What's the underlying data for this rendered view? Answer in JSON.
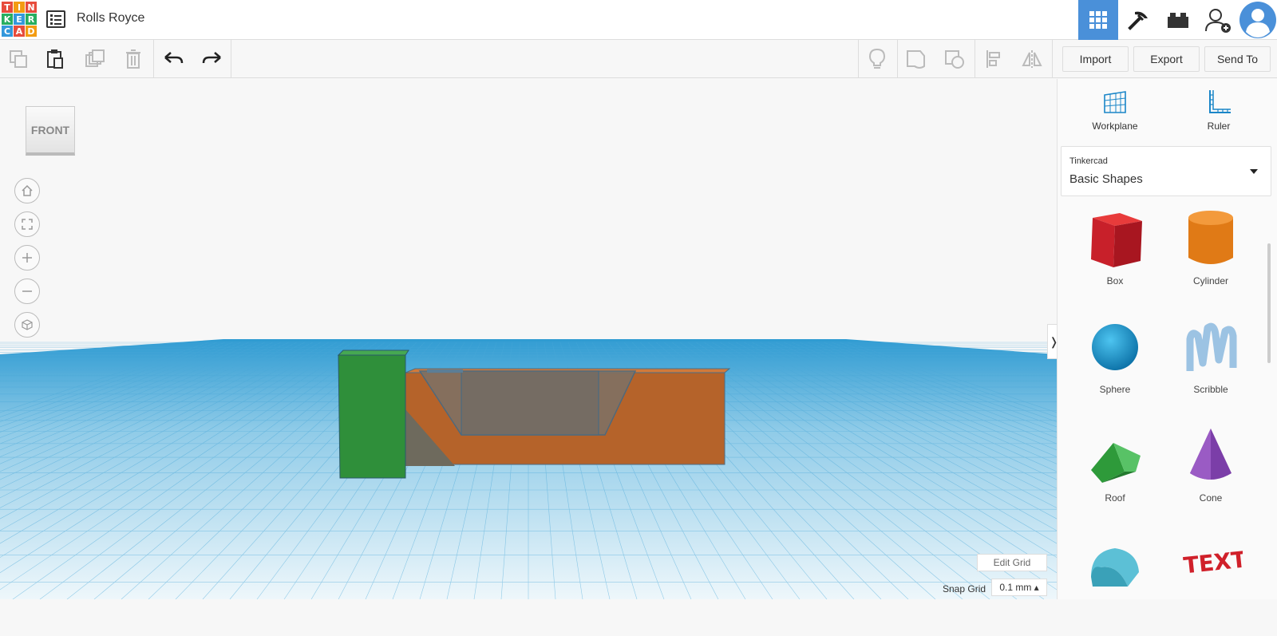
{
  "app": {
    "logo_letters": [
      "T",
      "I",
      "N",
      "K",
      "E",
      "R",
      "C",
      "A",
      "D"
    ],
    "logo_colors": [
      "#e74c3c",
      "#f39c12",
      "#e74c3c",
      "#27ae60",
      "#3498db",
      "#27ae60",
      "#3498db",
      "#e74c3c",
      "#f39c12"
    ],
    "document_title": "Rolls Royce"
  },
  "topbar": {
    "right_icons": [
      "grid-view-icon",
      "pickaxe-icon",
      "brick-icon",
      "add-user-icon",
      "avatar"
    ],
    "active_accent": "#4a90d9"
  },
  "toolbar": {
    "left_icons": [
      "copy-icon",
      "paste-icon",
      "duplicate-icon",
      "delete-icon",
      "undo-icon",
      "redo-icon"
    ],
    "right_icons": [
      "lightbulb-icon",
      "group-icon",
      "ungroup-icon",
      "align-icon",
      "mirror-icon"
    ],
    "import_label": "Import",
    "export_label": "Export",
    "sendto_label": "Send To"
  },
  "workspace": {
    "viewcube_label": "FRONT",
    "nav_icons": [
      "home-icon",
      "fit-icon",
      "zoom-in-icon",
      "zoom-out-icon",
      "perspective-icon"
    ],
    "edit_grid_label": "Edit Grid",
    "snap_grid_label": "Snap Grid",
    "snap_grid_value": "0.1 mm ▴",
    "collapse_glyph": "❭",
    "grid_color": "#4aa8d8",
    "shapes_in_scene": [
      "green-box",
      "orange-box",
      "transparent-hole"
    ]
  },
  "panel": {
    "workplane_label": "Workplane",
    "ruler_label": "Ruler",
    "library_source": "Tinkercad",
    "library_name": "Basic Shapes",
    "shapes": [
      {
        "label": "Box"
      },
      {
        "label": "Cylinder"
      },
      {
        "label": "Sphere"
      },
      {
        "label": "Scribble"
      },
      {
        "label": "Roof"
      },
      {
        "label": "Cone"
      }
    ]
  }
}
